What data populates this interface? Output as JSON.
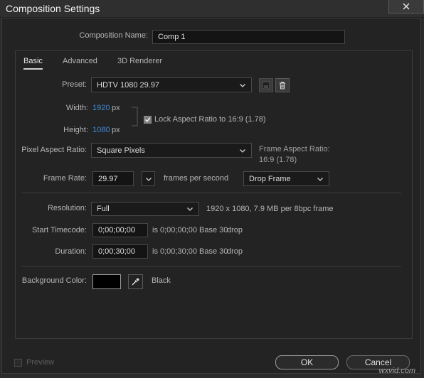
{
  "window": {
    "title": "Composition Settings",
    "close_glyph": "✕"
  },
  "comp_name": {
    "label": "Composition Name:",
    "value": "Comp 1"
  },
  "tabs": [
    {
      "label": "Basic",
      "active": true
    },
    {
      "label": "Advanced",
      "active": false
    },
    {
      "label": "3D Renderer",
      "active": false
    }
  ],
  "preset": {
    "label": "Preset:",
    "value": "HDTV 1080 29.97",
    "save_icon": "save-preset-icon",
    "delete_icon": "trash-icon"
  },
  "width": {
    "label": "Width:",
    "value": "1920",
    "unit": "px"
  },
  "height": {
    "label": "Height:",
    "value": "1080",
    "unit": "px"
  },
  "lock_aspect": {
    "label": "Lock Aspect Ratio to 16:9 (1.78)",
    "checked": true
  },
  "pixel_aspect": {
    "label": "Pixel Aspect Ratio:",
    "value": "Square Pixels"
  },
  "frame_aspect": {
    "line1": "Frame Aspect Ratio:",
    "line2": "16:9 (1.78)"
  },
  "frame_rate": {
    "label": "Frame Rate:",
    "value": "29.97",
    "unit": "frames per second",
    "drop": "Drop Frame"
  },
  "resolution": {
    "label": "Resolution:",
    "value": "Full",
    "info": "1920 x 1080, 7.9 MB per 8bpc frame"
  },
  "start_timecode": {
    "label": "Start Timecode:",
    "value": "0;00;00;00",
    "info": "is 0;00;00;00",
    "base": "Base 30",
    "drop": "drop"
  },
  "duration": {
    "label": "Duration:",
    "value": "0;00;30;00",
    "info": "is 0;00;30;00",
    "base": "Base 30",
    "drop": "drop"
  },
  "background": {
    "label": "Background Color:",
    "color": "#000000",
    "name": "Black"
  },
  "footer": {
    "preview_label": "Preview",
    "ok_label": "OK",
    "cancel_label": "Cancel"
  },
  "watermark": "wxvid.com",
  "colors": {
    "accent_blue": "#3d8bdc",
    "bg": "#2b2b2b"
  }
}
